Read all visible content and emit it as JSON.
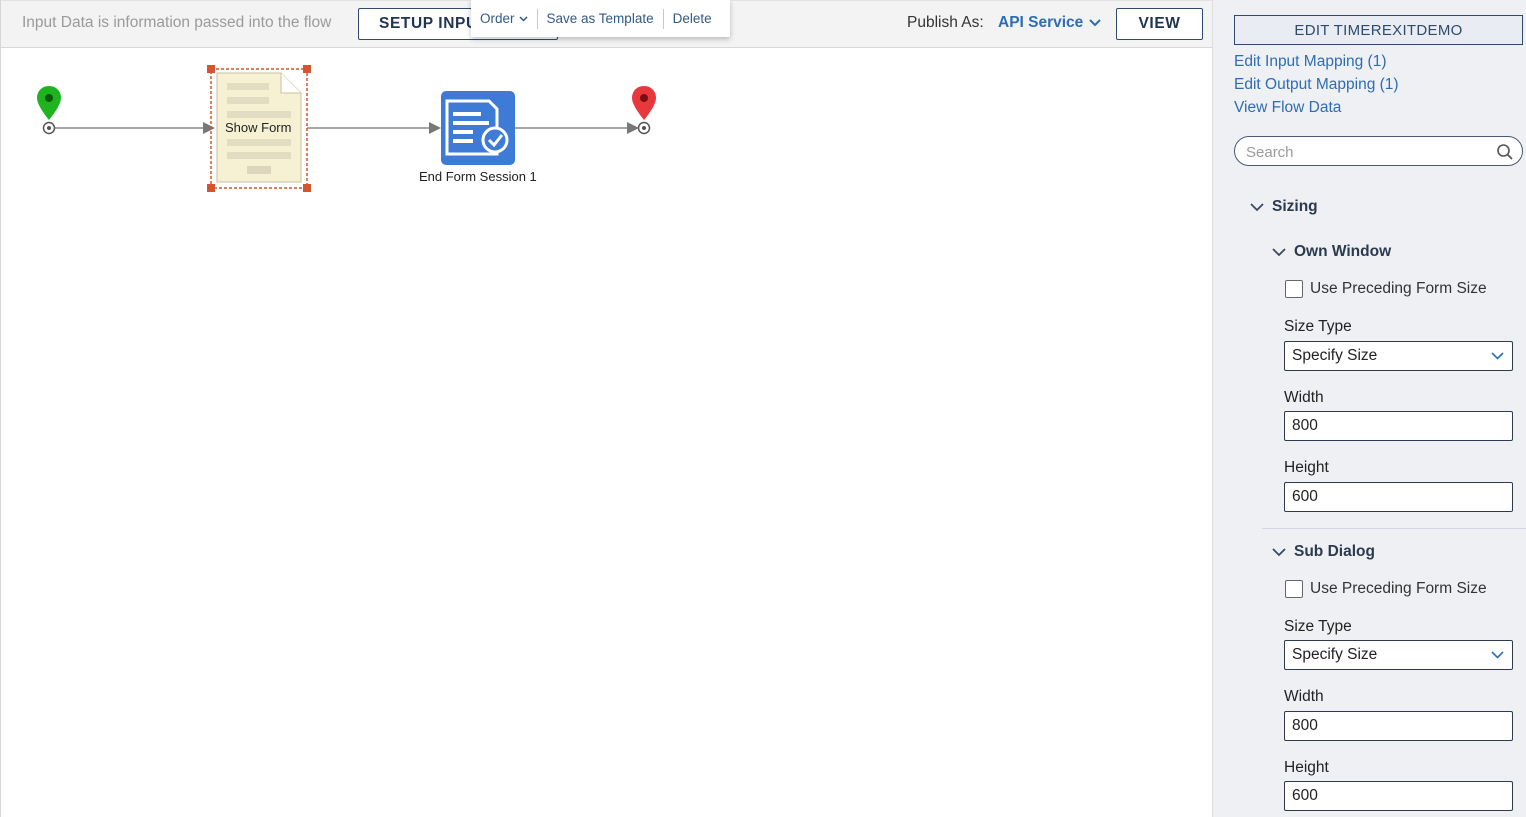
{
  "toolbar": {
    "hint": "Input Data is information passed into the flow",
    "setup_label": "SETUP INPUTS",
    "publish_label": "Publish As:",
    "publish_value": "API Service",
    "view_label": "VIEW"
  },
  "context_menu": {
    "order": "Order",
    "save_template": "Save as Template",
    "delete": "Delete"
  },
  "canvas": {
    "nodes": {
      "show_form": "Show Form",
      "end_form_session": "End Form Session 1"
    },
    "colors": {
      "start": "#1fb41f",
      "end": "#e8383d",
      "step": "#3d7bd6",
      "selection": "#d4552e"
    }
  },
  "panel": {
    "edit_button": "EDIT TIMEREXITDEMO",
    "links": [
      "Edit Input Mapping (1)",
      "Edit Output Mapping (1)",
      "View Flow Data"
    ],
    "search_placeholder": "Search",
    "sizing": {
      "title": "Sizing",
      "own_window": {
        "title": "Own Window",
        "checkbox": "Use Preceding Form Size",
        "size_type_label": "Size Type",
        "size_type_value": "Specify Size",
        "width_label": "Width",
        "width_value": "800",
        "height_label": "Height",
        "height_value": "600"
      },
      "sub_dialog": {
        "title": "Sub Dialog",
        "checkbox": "Use Preceding Form Size",
        "size_type_label": "Size Type",
        "size_type_value": "Specify Size",
        "width_label": "Width",
        "width_value": "800",
        "height_label": "Height",
        "height_value": "600"
      }
    }
  }
}
